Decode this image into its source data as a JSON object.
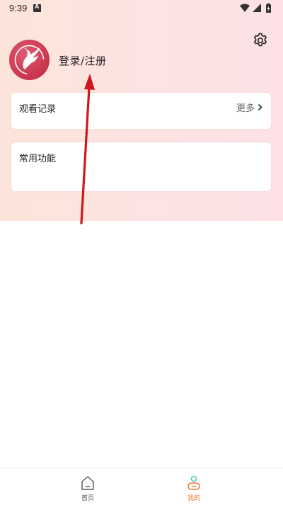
{
  "status_bar": {
    "time": "9:39",
    "notification_letter": "A"
  },
  "header": {
    "login_text": "登录/注册"
  },
  "history_card": {
    "title": "观看记录",
    "more_label": "更多"
  },
  "functions_card": {
    "title": "常用功能"
  },
  "bottom_nav": {
    "home_label": "首页",
    "mine_label": "我的"
  },
  "colors": {
    "accent": "#f07a34",
    "avatar": "#c9344d",
    "arrow": "#d0151c"
  }
}
